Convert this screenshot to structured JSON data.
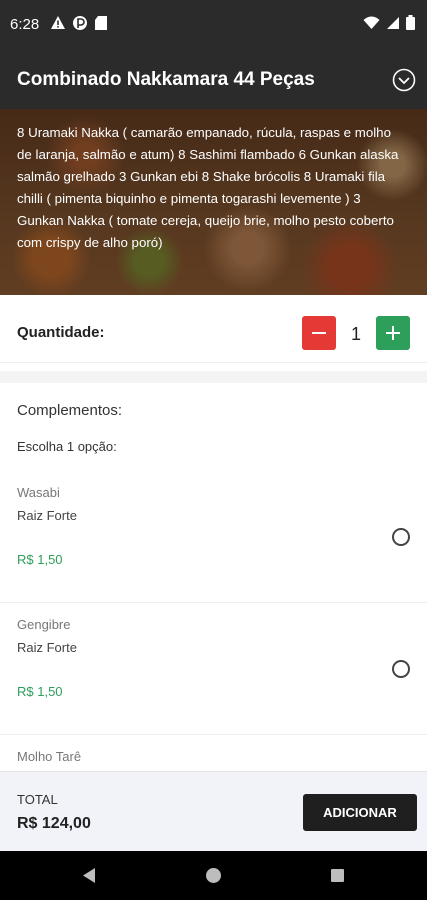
{
  "status_bar": {
    "time": "6:28",
    "left_icons": [
      "alert-icon",
      "data-saver-icon",
      "sd-card-icon"
    ],
    "right_icons": [
      "wifi-icon",
      "signal-icon",
      "battery-icon"
    ]
  },
  "header": {
    "title": "Combinado Nakkamara 44 Peças",
    "collapse_icon": "chevron-down-circle-icon",
    "background": "#2b2b2b"
  },
  "product": {
    "description": "8 Uramaki Nakka ( camarão empanado, rúcula, raspas e molho de laranja, salmão e atum) 8 Sashimi flambado 6 Gunkan alaska salmão grelhado 3 Gunkan ebi 8 Shake brócolis 8 Uramaki fila chilli ( pimenta biquinho e pimenta togarashi levemente ) 3 Gunkan Nakka ( tomate cereja, queijo brie, molho pesto coberto com crispy de alho poró)"
  },
  "quantity": {
    "label": "Quantidade:",
    "value": "1",
    "minus_color": "#e53935",
    "plus_color": "#2e9e5b"
  },
  "complements": {
    "title": "Complementos:",
    "subtitle": "Escolha 1 opção:",
    "options": [
      {
        "name": "Wasabi",
        "description": "Raiz Forte",
        "price": "R$ 1,50",
        "selected": false
      },
      {
        "name": "Gengibre",
        "description": "Raiz Forte",
        "price": "R$ 1,50",
        "selected": false
      },
      {
        "name": "Molho Tarê",
        "description": "",
        "price": "",
        "selected": false
      }
    ],
    "price_color": "#2e9e5b"
  },
  "footer": {
    "total_label": "TOTAL",
    "total_value": "R$ 124,00",
    "add_button": "ADICIONAR"
  },
  "nav_bar": {
    "icons": [
      "back-icon",
      "home-icon",
      "recents-icon"
    ]
  }
}
